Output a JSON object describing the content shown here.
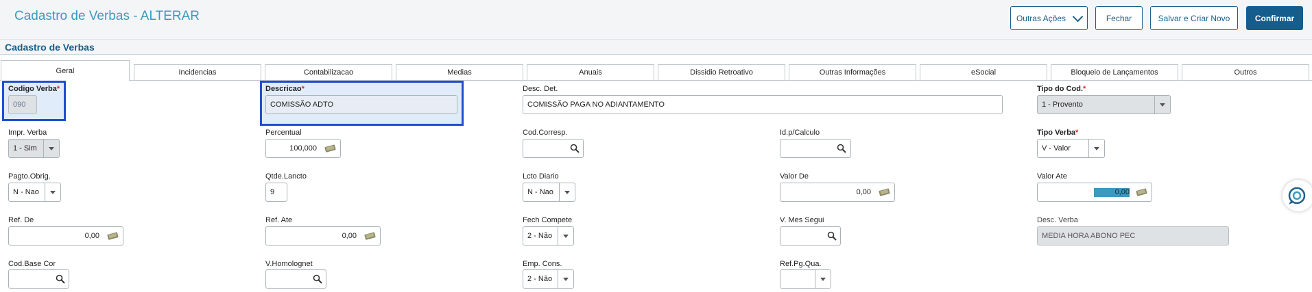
{
  "header": {
    "title": "Cadastro de Verbas - ALTERAR",
    "buttons": {
      "outras_acoes": "Outras Ações",
      "fechar": "Fechar",
      "salvar_novo": "Salvar e Criar Novo",
      "confirmar": "Confirmar"
    }
  },
  "section_title": "Cadastro de Verbas",
  "tabs": [
    "Geral",
    "Incidencias",
    "Contabilizacao",
    "Medias",
    "Anuais",
    "Dissidio Retroativo",
    "Outras Informações",
    "eSocial",
    "Bloqueio de Lançamentos",
    "Outros"
  ],
  "fields": {
    "codigo_verba": {
      "label": "Codigo Verba",
      "value": "090"
    },
    "descricao": {
      "label": "Descricao",
      "value": "COMISSÃO ADTO"
    },
    "desc_det": {
      "label": "Desc. Det.",
      "value": "COMISSÃO PAGA NO ADIANTAMENTO"
    },
    "tipo_cod": {
      "label": "Tipo do Cod.",
      "value": "1 - Provento"
    },
    "impr_verba": {
      "label": "Impr. Verba",
      "value": "1 - Sim"
    },
    "percentual": {
      "label": "Percentual",
      "value": "100,000"
    },
    "cod_corresp": {
      "label": "Cod.Corresp.",
      "value": ""
    },
    "id_calculo": {
      "label": "Id.p/Calculo",
      "value": ""
    },
    "tipo_verba": {
      "label": "Tipo Verba",
      "value": "V - Valor"
    },
    "pagto_obrig": {
      "label": "Pagto.Obrig.",
      "value": "N - Nao"
    },
    "qtde_lancto": {
      "label": "Qtde.Lancto",
      "value": "9"
    },
    "lcto_diario": {
      "label": "Lcto Diario",
      "value": "N - Nao"
    },
    "valor_de": {
      "label": "Valor De",
      "value": "0,00"
    },
    "valor_ate": {
      "label": "Valor Ate",
      "value": "0,00"
    },
    "ref_de": {
      "label": "Ref. De",
      "value": "0,00"
    },
    "ref_ate": {
      "label": "Ref. Ate",
      "value": "0,00"
    },
    "fech_compete": {
      "label": "Fech Compete",
      "value": "2 - Não"
    },
    "v_mes_segui": {
      "label": "V. Mes Segui",
      "value": ""
    },
    "desc_verba": {
      "label": "Desc. Verba",
      "value": "MEDIA HORA ABONO PEC"
    },
    "cod_base_cor": {
      "label": "Cod.Base Cor",
      "value": ""
    },
    "v_homolognet": {
      "label": "V.Homolognet",
      "value": ""
    },
    "emp_cons": {
      "label": "Emp. Cons.",
      "value": "2 - Não"
    },
    "ref_pg_qua": {
      "label": "Ref.Pg.Qua.",
      "value": ""
    }
  },
  "required_mark": "*",
  "colors": {
    "title": "#3a9bbf",
    "primary": "#155d8c",
    "highlight": "#1f4fd0",
    "selection": "#3a9bbf"
  }
}
